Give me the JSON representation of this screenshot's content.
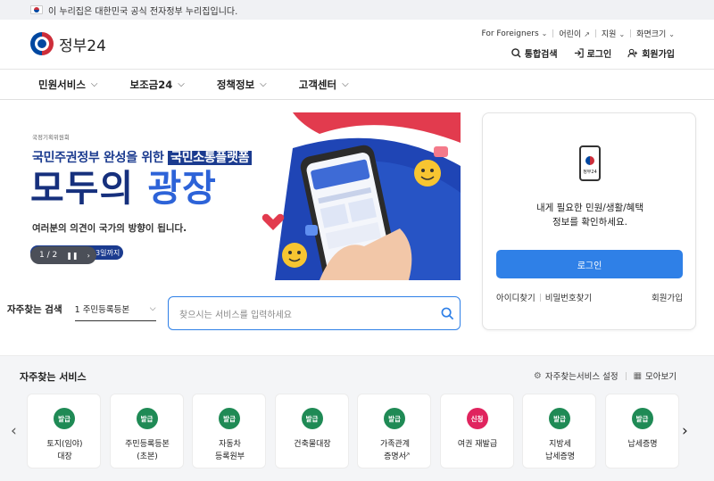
{
  "gov_notice": "이 누리집은 대한민국 공식 전자정부 누리집입니다.",
  "logo": {
    "text": "정부24"
  },
  "util_links": [
    "For Foreigners",
    "어린이",
    "지원",
    "화면크기"
  ],
  "actions": {
    "search": "통합검색",
    "login": "로그인",
    "join": "회원가입"
  },
  "nav": [
    "민원서비스",
    "보조금24",
    "정책정보",
    "고객센터"
  ],
  "banner": {
    "org": "국정기획위원회",
    "subtitle_prefix": "국민주권정부 완성을 위한",
    "subtitle_highlight": "국민소통플랫폼",
    "main_plain": "모두의",
    "main_accent": "광장",
    "description": "여러분의 의견이 국가의 방향이 됩니다.",
    "date": "~ 12.23일까지",
    "pager": "1 / 2"
  },
  "login_card": {
    "phone_text": "정부24",
    "message_line1": "내게 필요한 민원/생활/혜택",
    "message_line2": "정보를 확인하세요.",
    "login_button": "로그인",
    "find_id": "아이디찾기",
    "find_pw": "비밀번호찾기",
    "join": "회원가입"
  },
  "search": {
    "label": "자주찾는 검색",
    "selected": "1 주민등록등본",
    "placeholder": "찾으시는 서비스를 입력하세요"
  },
  "services": {
    "title": "자주찾는 서비스",
    "settings": "자주찾는서비스 설정",
    "view_all": "모아보기",
    "items": [
      {
        "badge": "발급",
        "label": "토지(임야)\n대장"
      },
      {
        "badge": "발급",
        "label": "주민등록등본\n(초본)"
      },
      {
        "badge": "발급",
        "label": "자동차\n등록원부"
      },
      {
        "badge": "발급",
        "label": "건축물대장"
      },
      {
        "badge": "발급",
        "label": "가족관계\n증명서"
      },
      {
        "badge": "신청",
        "label": "여권 재발급"
      },
      {
        "badge": "발급",
        "label": "지방세\n납세증명"
      },
      {
        "badge": "발급",
        "label": "납세증명"
      }
    ]
  },
  "colors": {
    "primary": "#2f80e7",
    "navy": "#16307d",
    "badge_green": "#1f8a55",
    "badge_red": "#e0245e"
  }
}
